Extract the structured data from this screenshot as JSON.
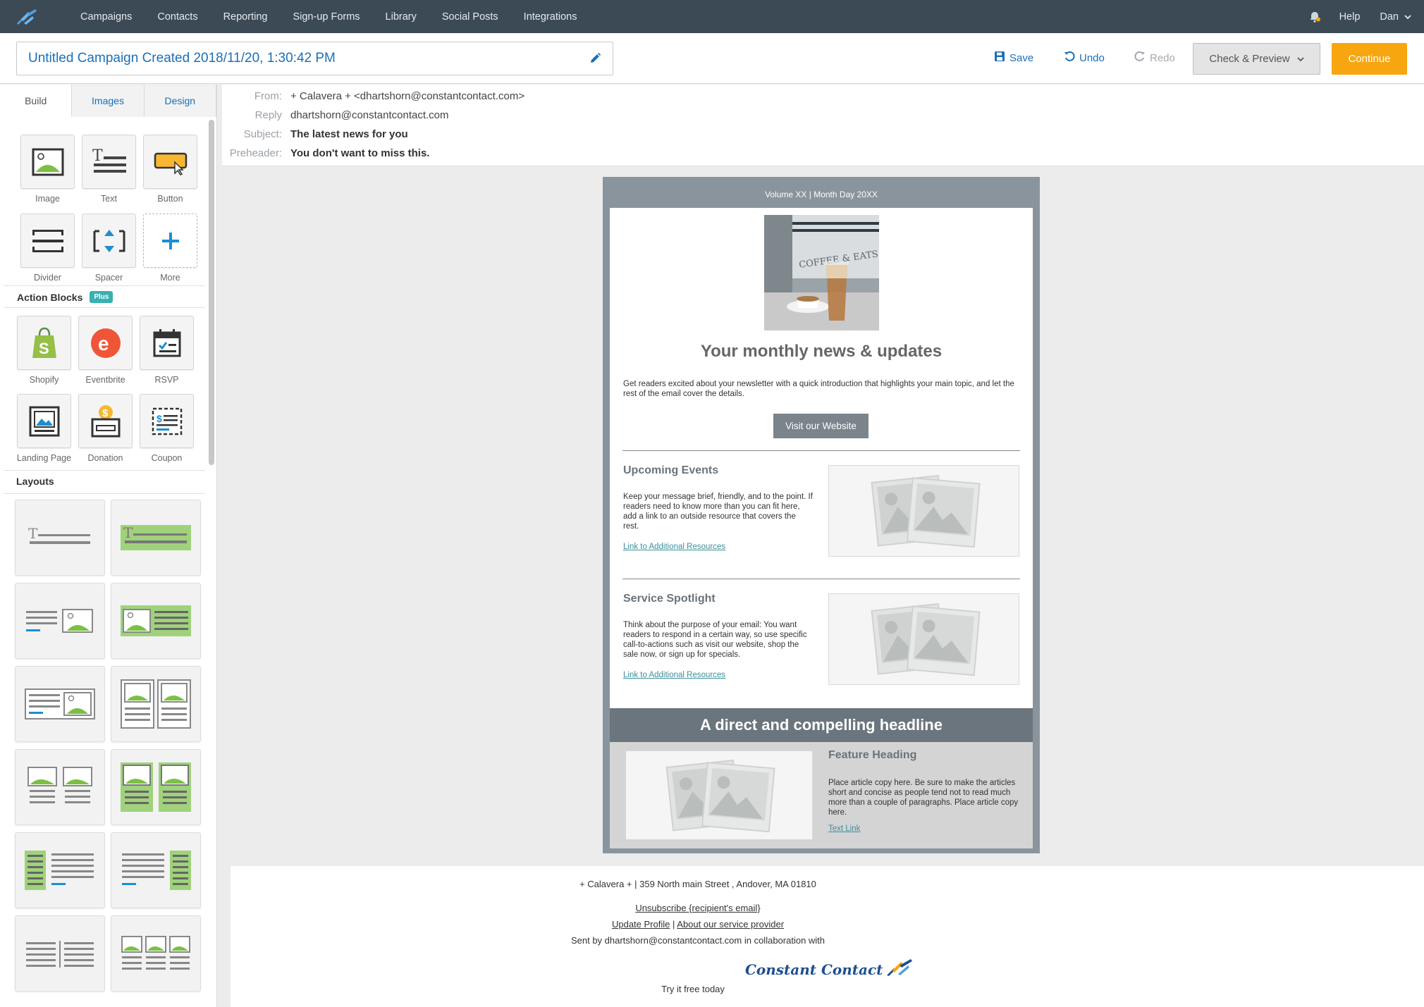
{
  "nav": {
    "items": [
      {
        "label": "Campaigns"
      },
      {
        "label": "Contacts"
      },
      {
        "label": "Reporting"
      },
      {
        "label": "Sign-up Forms"
      },
      {
        "label": "Library"
      },
      {
        "label": "Social Posts"
      },
      {
        "label": "Integrations"
      }
    ],
    "help": "Help",
    "user": "Dan",
    "bell_icon": "bell-icon",
    "logo_icon": "constant-contact-logo"
  },
  "toolbar": {
    "campaign_title": "Untitled Campaign Created 2018/11/20, 1:30:42 PM",
    "save": "Save",
    "undo": "Undo",
    "redo": "Redo",
    "check_preview": "Check & Preview",
    "continue": "Continue"
  },
  "sidebar": {
    "tabs": [
      {
        "label": "Build",
        "active": true
      },
      {
        "label": "Images",
        "active": false
      },
      {
        "label": "Design",
        "active": false
      }
    ],
    "blocks": [
      {
        "label": "Image",
        "icon": "image-block-icon"
      },
      {
        "label": "Text",
        "icon": "text-block-icon"
      },
      {
        "label": "Button",
        "icon": "button-block-icon"
      },
      {
        "label": "Divider",
        "icon": "divider-block-icon"
      },
      {
        "label": "Spacer",
        "icon": "spacer-block-icon"
      },
      {
        "label": "More",
        "icon": "plus-icon"
      }
    ],
    "action_blocks_title": "Action Blocks",
    "plus_badge": "Plus",
    "action_blocks": [
      {
        "label": "Shopify",
        "icon": "shopify-icon"
      },
      {
        "label": "Eventbrite",
        "icon": "eventbrite-icon"
      },
      {
        "label": "RSVP",
        "icon": "rsvp-calendar-icon"
      },
      {
        "label": "Landing Page",
        "icon": "landing-page-icon"
      },
      {
        "label": "Donation",
        "icon": "donation-icon"
      },
      {
        "label": "Coupon",
        "icon": "coupon-icon"
      }
    ],
    "layouts_title": "Layouts"
  },
  "headers": {
    "from_label": "From:",
    "from_value": "+ Calavera + <dhartshorn@constantcontact.com>",
    "reply_label": "Reply",
    "reply_value": "dhartshorn@constantcontact.com",
    "subject_label": "Subject:",
    "subject_value": "The latest news for you",
    "preheader_label": "Preheader:",
    "preheader_value": "You don't want to miss this."
  },
  "email": {
    "volume": "Volume XX | Month Day 20XX",
    "main_heading": "Your monthly news & updates",
    "intro": "Get readers excited about your newsletter with a quick introduction that highlights your main topic, and let the rest of the email cover the details.",
    "button": "Visit our Website",
    "events_heading": "Upcoming Events",
    "events_body": "Keep your message brief, friendly, and to the point. If readers need to know more than you can fit here, add a link to an outside resource that covers the rest.",
    "events_link": "Link to Additional Resources",
    "service_heading": "Service Spotlight",
    "service_body": "Think about the purpose of your email: You want readers to respond in a certain way, so use specific call-to-actions such as visit our website, shop the sale now, or sign up for specials.",
    "service_link": "Link to Additional Resources",
    "headline": "A direct and compelling headline",
    "feature_heading": "Feature Heading",
    "feature_body": "Place article copy here. Be sure to make the articles short and concise as people tend not to read much more than a couple of paragraphs. Place article copy here.",
    "feature_link": "Text Link"
  },
  "footer": {
    "address": "+ Calavera + | 359 North main Street , Andover, MA 01810",
    "unsubscribe": "Unsubscribe {recipient's email}",
    "update_profile": "Update Profile",
    "separator": "|",
    "about": "About our service provider",
    "sent_by": "Sent by dhartshorn@constantcontact.com in collaboration with",
    "brand": "Constant Contact",
    "tagline": "Try it free today"
  },
  "colors": {
    "nav_bg": "#3c4a56",
    "accent_blue": "#1b6fb5",
    "continue_orange": "#f7a60f",
    "email_frame": "#8a949c"
  }
}
